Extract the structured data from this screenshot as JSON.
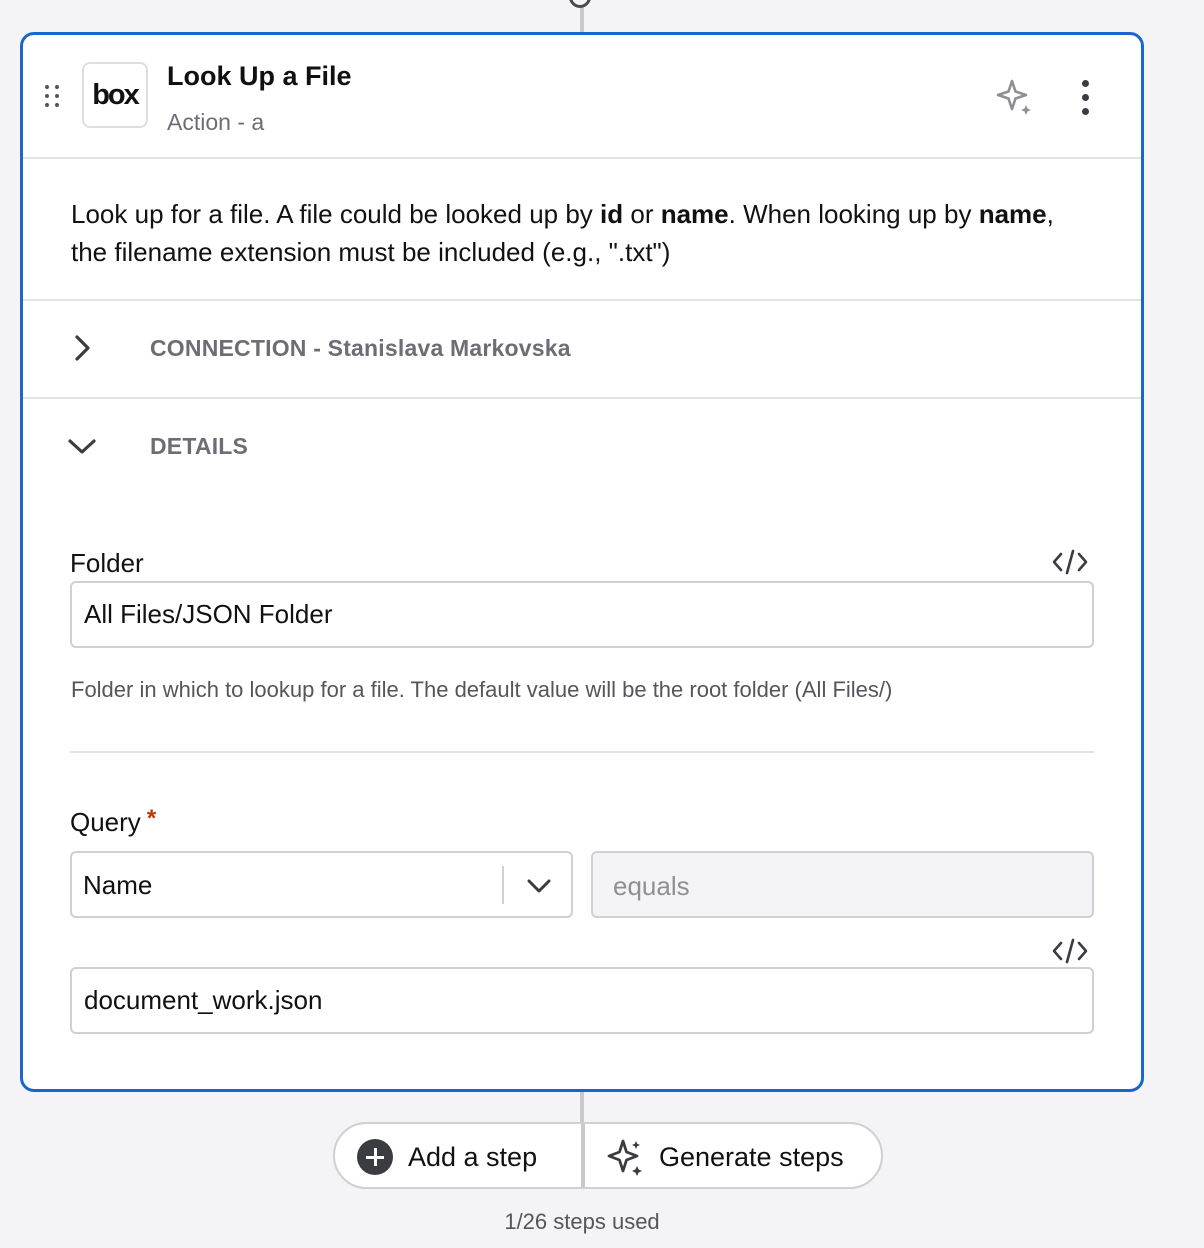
{
  "step": {
    "title": "Look Up a File",
    "subtitle": "Action - a",
    "app_logo_text": "box",
    "icons": {
      "drag": "drag-handle-icon",
      "ai": "sparkle-icon",
      "more": "more-vertical-icon"
    }
  },
  "description": {
    "part1": "Look up for a file. A file could be looked up by ",
    "bold1": "id",
    "part2": " or ",
    "bold2": "name",
    "part3": ". When looking up by ",
    "bold3": "name",
    "part4": ", the filename extension must be included (e.g., \".txt\")"
  },
  "sections": {
    "connection": {
      "label": "CONNECTION - Stanislava Markovska",
      "expanded": false
    },
    "details": {
      "label": "DETAILS",
      "expanded": true
    }
  },
  "fields": {
    "folder": {
      "label": "Folder",
      "value": "All Files/JSON Folder",
      "hint": "Folder in which to lookup for a file. The default value will be the root folder (All Files/)"
    },
    "query": {
      "label": "Query",
      "required_mark": "*",
      "field_select": "Name",
      "operator": "equals",
      "value": "document_work.json"
    }
  },
  "footer": {
    "add_step": "Add a step",
    "generate_steps": "Generate steps",
    "steps_used": "1/26 steps used"
  },
  "colors": {
    "accent_border": "#1b66c9",
    "required": "#c4320a",
    "muted_text": "#6d6e75"
  }
}
